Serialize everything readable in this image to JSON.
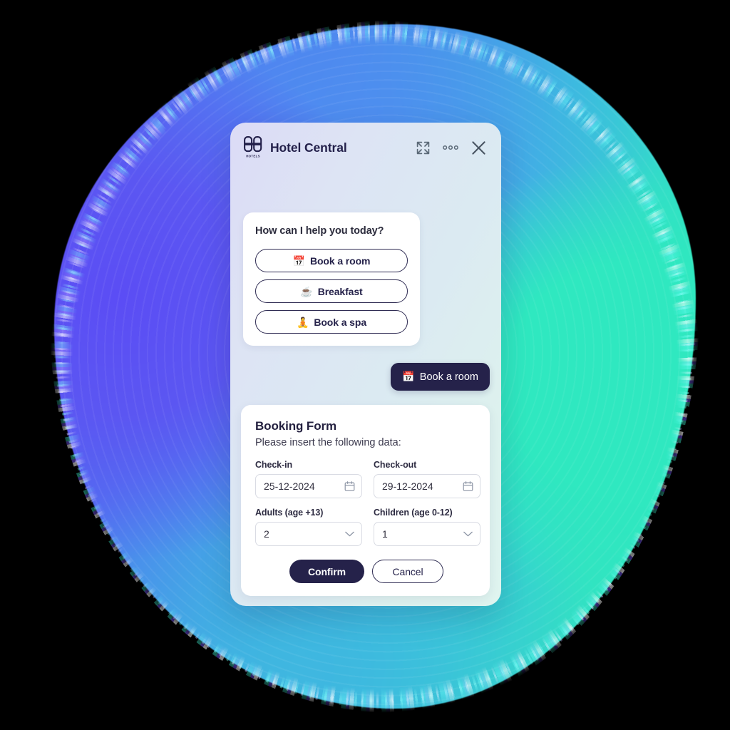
{
  "background": {
    "shape_name": "gradient-blob",
    "colors": {
      "violet": "#5A4EF5",
      "blue": "#4D86EF",
      "cyan": "#38C6DC",
      "turquoise": "#2FE8C0"
    }
  },
  "panel": {
    "header": {
      "logo_label": "HOTELS",
      "brand_name": "Hotel Central",
      "actions": [
        {
          "name": "expand-icon",
          "label": "Expand"
        },
        {
          "name": "more-options-icon",
          "label": "More options"
        },
        {
          "name": "close-icon",
          "label": "Close"
        }
      ]
    },
    "colors": {
      "accent_dark": "#25224A",
      "panel_gradient_start": "#DCDBF6",
      "panel_gradient_end": "#DFF4EF"
    }
  },
  "conversation": {
    "bot_card": {
      "title": "How can I help you today?",
      "options": [
        {
          "emoji": "📅",
          "emoji_name": "calendar-emoji",
          "label": "Book a room"
        },
        {
          "emoji": "☕",
          "emoji_name": "coffee-emoji",
          "label": "Breakfast"
        },
        {
          "emoji": "🧘",
          "emoji_name": "lotus-position-emoji",
          "label": "Book a spa"
        }
      ]
    },
    "user_message": {
      "emoji": "📅",
      "emoji_name": "calendar-emoji",
      "text": "Book a room"
    }
  },
  "booking_form": {
    "title": "Booking Form",
    "subtitle": "Please insert the following data:",
    "fields": [
      {
        "name": "check-in",
        "label": "Check-in",
        "value": "25-12-2024",
        "icon": "calendar-icon",
        "type": "date"
      },
      {
        "name": "check-out",
        "label": "Check-out",
        "value": "29-12-2024",
        "icon": "calendar-icon",
        "type": "date"
      },
      {
        "name": "adults",
        "label": "Adults (age +13)",
        "value": "2",
        "icon": "chevron-down-icon",
        "type": "select"
      },
      {
        "name": "children",
        "label": "Children (age 0-12)",
        "value": "1",
        "icon": "chevron-down-icon",
        "type": "select"
      }
    ],
    "confirm_label": "Confirm",
    "cancel_label": "Cancel"
  }
}
